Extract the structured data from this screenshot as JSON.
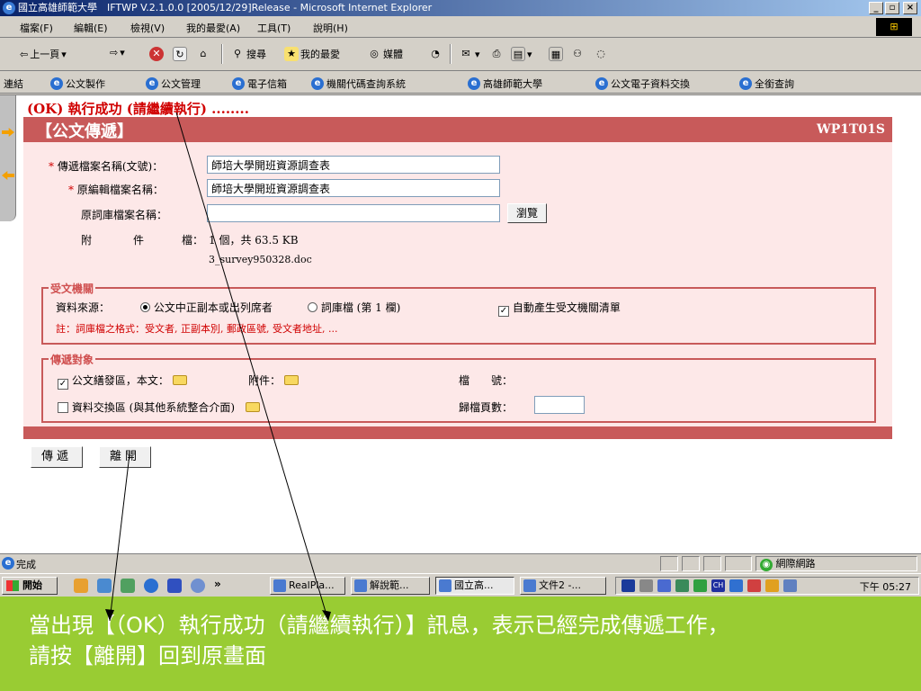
{
  "window": {
    "title": "國立高雄師範大學　IFTWP V.2.1.0.0 [2005/12/29]Release - Microsoft Internet Explorer",
    "minimize": "_",
    "maximize": "▫",
    "close": "×"
  },
  "menu": {
    "items": [
      "檔案(F)",
      "編輯(E)",
      "檢視(V)",
      "我的最愛(A)",
      "工具(T)",
      "說明(H)"
    ]
  },
  "toolbar": {
    "back": "上一頁",
    "search": "搜尋",
    "favorites": "我的最愛",
    "media": "媒體"
  },
  "links": {
    "label": "連結",
    "items": [
      "公文製作",
      "公文管理",
      "電子信箱",
      "機關代碼查詢系統",
      "高雄師範大學",
      "公文電子資料交換",
      "全銜查詢"
    ]
  },
  "page": {
    "ok_message": "(OK) 執行成功 (請繼續執行) ........",
    "form_title": "【公文傳遞】",
    "form_code": "WP1T01S",
    "fields": {
      "transfer_file_label": "傳遞檔案名稱(文號)：",
      "transfer_file_value": "師培大學開班資源調查表",
      "orig_file_label": "原編輯檔案名稱：",
      "orig_file_value": "師培大學開班資源調查表",
      "word_db_label": "原詞庫檔案名稱：",
      "word_db_value": "",
      "browse_button": "瀏覽",
      "attach_label_1": "附",
      "attach_label_2": "件",
      "attach_label_3": "檔：",
      "attach_summary": "1 個，共 63.5 KB",
      "attach_file": "3_survey950328.doc"
    },
    "recv_section": {
      "legend": "受文機關",
      "source_label": "資料來源：",
      "option_1": "公文中正副本或出列席者",
      "option_2": "詞庫檔 (第 1 欄)",
      "auto_list_label": "自動產生受文機關清單",
      "note": "註：詞庫檔之格式：受文者, 正副本別, 郵政區號, 受文者地址, ..."
    },
    "target_section": {
      "legend": "傳遞對象",
      "doc_area_label": "公文繕發區，本文：",
      "attach_label": "附件：",
      "exchange_label": "資料交換區 (與其他系統整合介面)",
      "file_no_label": "檔　　號：",
      "archive_pages_label": "歸檔頁數："
    },
    "buttons": {
      "send": "傳遞",
      "leave": "離開"
    }
  },
  "statusbar": {
    "text": "完成",
    "zone": "網際網路"
  },
  "taskbar": {
    "start": "開始",
    "more": "»",
    "tasks": [
      "RealPla...",
      "解說範...",
      "國立高...",
      "文件2 -..."
    ],
    "clock": "下午 05:27",
    "ime": "CH"
  },
  "caption": {
    "line1": "當出現【（OK）執行成功（請繼續執行）】訊息，表示已經完成傳遞工作，",
    "line2": "請按【離開】回到原畫面"
  },
  "colors": {
    "form_header": "#c85a5a",
    "form_body": "#fde8e8",
    "ok_text": "#d00000",
    "caption_bg": "#99cc33"
  }
}
